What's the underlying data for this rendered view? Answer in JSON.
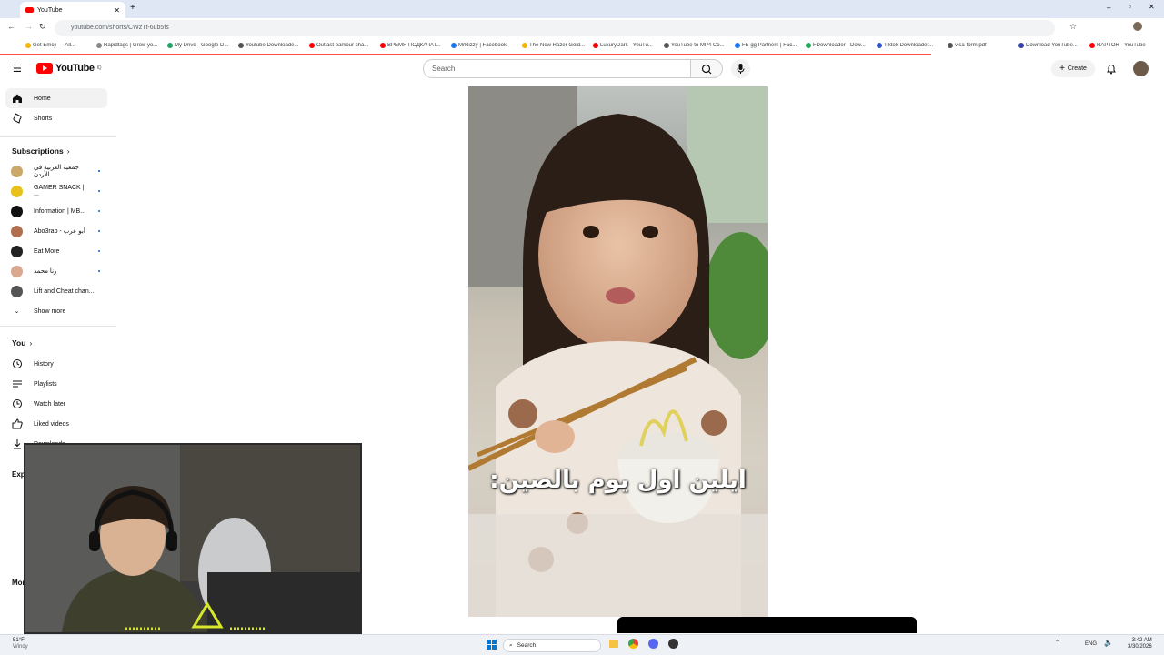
{
  "browser": {
    "tab_title": "YouTube",
    "url": "youtube.com/shorts/CWzTt-6Lb5fs",
    "bookmarks": [
      {
        "label": "Get Emoji — All...",
        "color": "#f5b400"
      },
      {
        "label": "Rapidtags | Grow yo...",
        "color": "#888888"
      },
      {
        "label": "My Drive - Google D...",
        "color": "#1fa463"
      },
      {
        "label": "Youtube Downloade...",
        "color": "#555555"
      },
      {
        "label": "Outlast parkour cha...",
        "color": "#ff0000"
      },
      {
        "label": "ВРЕМЯ ПОДКАЧАТ...",
        "color": "#ff0000"
      },
      {
        "label": "MrRizzy | Facebook",
        "color": "#1877f2"
      },
      {
        "label": "The New Razer Gold...",
        "color": "#f5b400"
      },
      {
        "label": "LuxuryDark - YouTu...",
        "color": "#ff0000"
      },
      {
        "label": "YouTube to MP4 Co...",
        "color": "#555555"
      },
      {
        "label": "FB gg Partners | Fac...",
        "color": "#1877f2"
      },
      {
        "label": "FDownloader - Dow...",
        "color": "#22aa55"
      },
      {
        "label": "Tiktok Downloader...",
        "color": "#3355cc"
      },
      {
        "label": "visa-form.pdf",
        "color": "#555555"
      },
      {
        "label": "Download YouTube...",
        "color": "#3344aa"
      },
      {
        "label": "RAPTOR - YouTube",
        "color": "#ff0000"
      }
    ]
  },
  "header": {
    "logo_text": "YouTube",
    "logo_region": "IQ",
    "search_placeholder": "Search",
    "create_label": "Create"
  },
  "sidebar": {
    "main": [
      {
        "label": "Home",
        "icon": "home-icon",
        "active": true
      },
      {
        "label": "Shorts",
        "icon": "shorts-icon",
        "active": false
      }
    ],
    "subscriptions_title": "Subscriptions",
    "subscriptions": [
      {
        "label": "جمعية العربية في الأردن",
        "color": "#c9a86a"
      },
      {
        "label": "GAMER SNACK | ...",
        "color": "#e8c21a"
      },
      {
        "label": "Information | MB...",
        "color": "#111111"
      },
      {
        "label": "Abo3rab - أبو عرب",
        "color": "#b07050"
      },
      {
        "label": "Eat More",
        "color": "#222222"
      },
      {
        "label": "رنا محمد",
        "color": "#d9a890"
      },
      {
        "label": "Lift and Cheat chan...",
        "color": "#555555"
      }
    ],
    "show_more": "Show more",
    "you_title": "You",
    "you_items": [
      {
        "label": "History",
        "icon": "history-icon"
      },
      {
        "label": "Playlists",
        "icon": "playlists-icon"
      },
      {
        "label": "Watch later",
        "icon": "watch-later-icon"
      },
      {
        "label": "Liked videos",
        "icon": "liked-videos-icon"
      },
      {
        "label": "Downloads",
        "icon": "downloads-icon"
      }
    ],
    "explore_title": "Explore",
    "more_title": "More"
  },
  "video": {
    "caption": "ايلين اول يوم بالصين:"
  },
  "taskbar": {
    "weather_temp": "51°F",
    "weather_text": "Windy",
    "search_label": "Search",
    "lang": "ENG",
    "time": "3:42 AM",
    "date": "3/30/2026"
  }
}
